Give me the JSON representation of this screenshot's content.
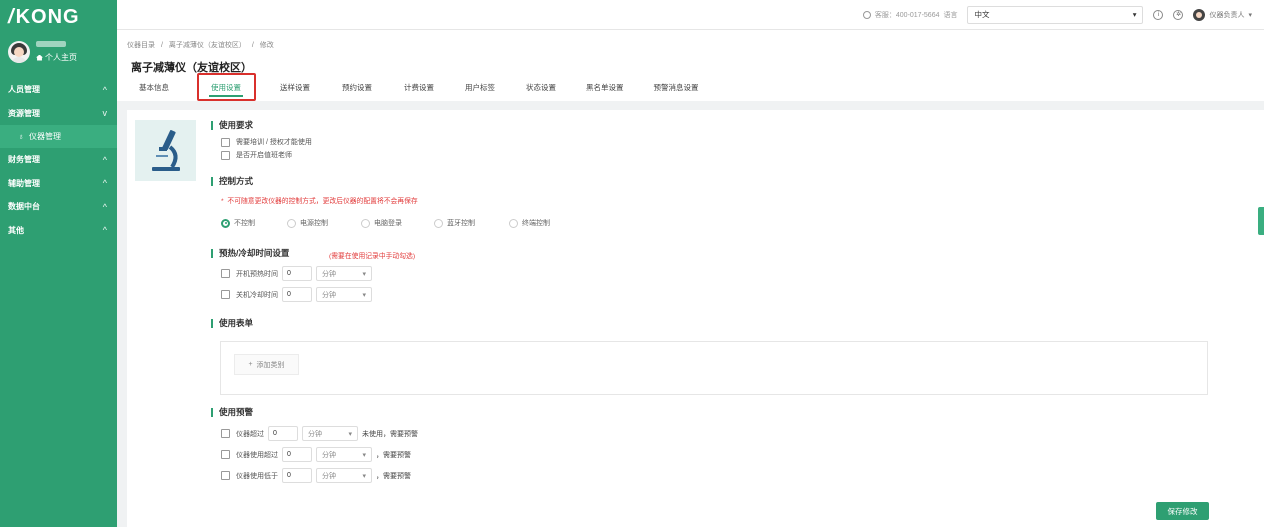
{
  "brand": {
    "logo_text": "KONG"
  },
  "sidebar": {
    "home_label": "个人主页",
    "items": [
      {
        "label": "人员管理",
        "chevron": "^"
      },
      {
        "label": "资源管理",
        "chevron": "v"
      },
      {
        "label": "仪器管理",
        "sub": true
      },
      {
        "label": "财务管理",
        "chevron": "^"
      },
      {
        "label": "辅助管理",
        "chevron": "^"
      },
      {
        "label": "数据中台",
        "chevron": "^"
      },
      {
        "label": "其他",
        "chevron": "^"
      }
    ]
  },
  "topbar": {
    "support_text": "客服：400-017-5664",
    "language_label": "语言",
    "language_value": "中文",
    "user_name": "仪器负责人"
  },
  "breadcrumb": [
    "仪器目录",
    "离子减薄仪（友谊校区）",
    "修改"
  ],
  "page_title": "离子减薄仪（友谊校区）",
  "tabs": [
    "基本信息",
    "使用设置",
    "送样设置",
    "预约设置",
    "计费设置",
    "用户标签",
    "状态设置",
    "黑名单设置",
    "预警消息设置"
  ],
  "usage_requirements": {
    "title": "使用要求",
    "options": [
      "需要培训 / 授权才能使用",
      "是否开启值班老师"
    ]
  },
  "control_mode": {
    "title": "控制方式",
    "warning": "不可随意更改仪器的控制方式，更改后仪器的配置将不会再保存",
    "options": [
      "不控制",
      "电源控制",
      "电脑登录",
      "蓝牙控制",
      "终端控制"
    ],
    "selected": "不控制"
  },
  "preheat": {
    "title": "预热/冷却时间设置",
    "hint": "(需要在使用记录中手动勾选)",
    "rows": [
      {
        "label": "开机预热时间",
        "value": "0",
        "unit": "分钟"
      },
      {
        "label": "关机冷却时间",
        "value": "0",
        "unit": "分钟"
      }
    ]
  },
  "usage_form": {
    "title": "使用表单",
    "add_label": "添加类别"
  },
  "usage_alert": {
    "title": "使用预警",
    "rows": [
      {
        "label": "仪器超过",
        "value": "0",
        "unit": "分钟",
        "suffix": "未使用，需要预警"
      },
      {
        "label": "仪器使用超过",
        "value": "0",
        "unit": "分钟",
        "suffix": "，需要预警"
      },
      {
        "label": "仪器使用低于",
        "value": "0",
        "unit": "分钟",
        "suffix": "，需要预警"
      }
    ]
  },
  "save_label": "保存修改",
  "colors": {
    "primary": "#2e9f72",
    "warning": "#e23b3b",
    "highlight": "#d9302c"
  }
}
